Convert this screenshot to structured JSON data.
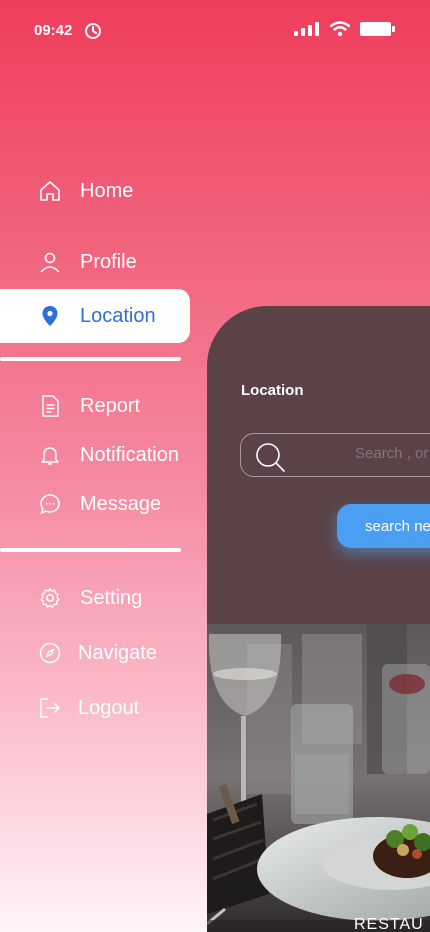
{
  "status": {
    "time": "09:42"
  },
  "menu": {
    "items": [
      {
        "label": "Home",
        "icon": "home-icon"
      },
      {
        "label": "Profile",
        "icon": "user-icon"
      },
      {
        "label": "Location",
        "icon": "location-pin-icon",
        "active": true
      },
      {
        "label": "Report",
        "icon": "document-icon"
      },
      {
        "label": "Notification",
        "icon": "bell-icon"
      },
      {
        "label": "Message",
        "icon": "chat-icon"
      },
      {
        "label": "Setting",
        "icon": "gear-icon"
      },
      {
        "label": "Navigate",
        "icon": "compass-icon"
      },
      {
        "label": "Logout",
        "icon": "logout-icon"
      }
    ]
  },
  "preview": {
    "title": "Location",
    "search_placeholder": "Search , or",
    "search_button": "search ne",
    "photo_caption": "RESTAU"
  },
  "colors": {
    "accent_blue": "#4a9ff2",
    "active_text": "#2e6fd8",
    "panel_bg": "#5b4246",
    "gradient_top": "#ef3d5c"
  }
}
